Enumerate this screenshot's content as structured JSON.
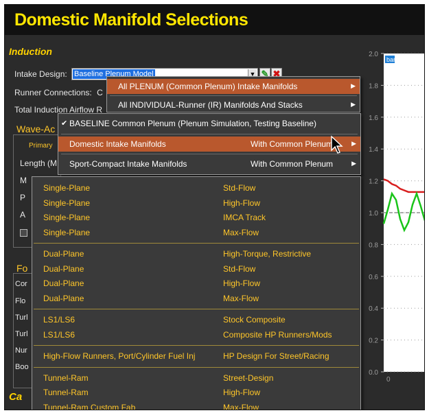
{
  "window": {
    "title": "Domestic Manifold Selections"
  },
  "induction": {
    "section_title": "Induction",
    "intake_label": "Intake Design:",
    "intake_value": "Baseline Plenum Model",
    "runner_label": "Runner Connections:",
    "runner_value": "C",
    "airflow_label": "Total Induction Airflow R"
  },
  "wave": {
    "title": "Wave-Ac",
    "primary_tab": "Primary",
    "length_label": "Length (M",
    "m_label": "M",
    "p_label": "P",
    "a_label": "A"
  },
  "fuel": {
    "title": "Fo",
    "rows": [
      "Cor",
      "Flo",
      "Turl",
      "Turl",
      "Nur",
      "Boo"
    ]
  },
  "cam": {
    "title": "Ca"
  },
  "chart": {
    "ytick_labels": [
      "2.0",
      "1.8",
      "1.6",
      "1.4",
      "1.2",
      "1.0",
      "0.8",
      "0.6",
      "0.4",
      "0.2",
      "0.0"
    ],
    "xtick_label": "0",
    "legend_label": "bar",
    "colors": {
      "series_red": "#d81e1e",
      "series_green": "#19c419"
    }
  },
  "chart_data": {
    "type": "line",
    "ylim": [
      0,
      2.0
    ],
    "legend": "top-left",
    "series": [
      {
        "x": [
          0,
          0.1,
          0.2,
          0.3,
          0.4,
          0.5,
          0.6,
          0.7,
          0.8,
          0.9,
          1.0
        ],
        "values": [
          1.21,
          1.2,
          1.18,
          1.17,
          1.15,
          1.14,
          1.13,
          1.13,
          1.13,
          1.13,
          1.13
        ]
      },
      {
        "x": [
          0,
          0.1,
          0.2,
          0.3,
          0.4,
          0.5,
          0.6,
          0.7,
          0.8,
          0.9,
          1.0
        ],
        "values": [
          0.93,
          1.02,
          1.12,
          1.08,
          0.96,
          0.89,
          0.94,
          1.05,
          1.12,
          1.04,
          0.95
        ]
      }
    ]
  },
  "menus": {
    "level1": [
      {
        "label": "All PLENUM (Common Plenum) Intake Manifolds",
        "highlighted": true,
        "has_submenu": true
      },
      {
        "label": "All INDIVIDUAL-Runner (IR) Manifolds And Stacks",
        "highlighted": false,
        "has_submenu": true
      }
    ],
    "level2": [
      {
        "label": "BASELINE Common Plenum  (Plenum Simulation, Testing Baseline)",
        "checked": true,
        "right": "",
        "highlighted": false,
        "has_submenu": false
      },
      {
        "label": "Domestic Intake Manifolds",
        "checked": false,
        "right": "With Common Plenum",
        "highlighted": true,
        "has_submenu": true
      },
      {
        "label": "Sport-Compact Intake Manifolds",
        "checked": false,
        "right": "With Common Plenum",
        "highlighted": false,
        "has_submenu": true
      }
    ],
    "check_glyph": "✔",
    "arrow_glyph": "▶"
  },
  "submenu": {
    "groups": [
      [
        {
          "type": "Single-Plane",
          "variant": "Std-Flow"
        },
        {
          "type": "Single-Plane",
          "variant": "High-Flow"
        },
        {
          "type": "Single-Plane",
          "variant": "IMCA Track"
        },
        {
          "type": "Single-Plane",
          "variant": "Max-Flow"
        }
      ],
      [
        {
          "type": "Dual-Plane",
          "variant": "High-Torque, Restrictive"
        },
        {
          "type": "Dual-Plane",
          "variant": "Std-Flow"
        },
        {
          "type": "Dual-Plane",
          "variant": "High-Flow"
        },
        {
          "type": "Dual-Plane",
          "variant": "Max-Flow"
        }
      ],
      [
        {
          "type": "LS1/LS6",
          "variant": "Stock Composite"
        },
        {
          "type": "LS1/LS6",
          "variant": "Composite HP Runners/Mods"
        }
      ],
      [
        {
          "type": "High-Flow Runners, Port/Cylinder Fuel Inj",
          "variant": "HP Design For Street/Racing"
        }
      ],
      [
        {
          "type": "Tunnel-Ram",
          "variant": "Street-Design"
        },
        {
          "type": "Tunnel-Ram",
          "variant": "High-Flow"
        },
        {
          "type": "Tunnel-Ram Custom Fab",
          "variant": "Max-Flow"
        }
      ]
    ]
  }
}
